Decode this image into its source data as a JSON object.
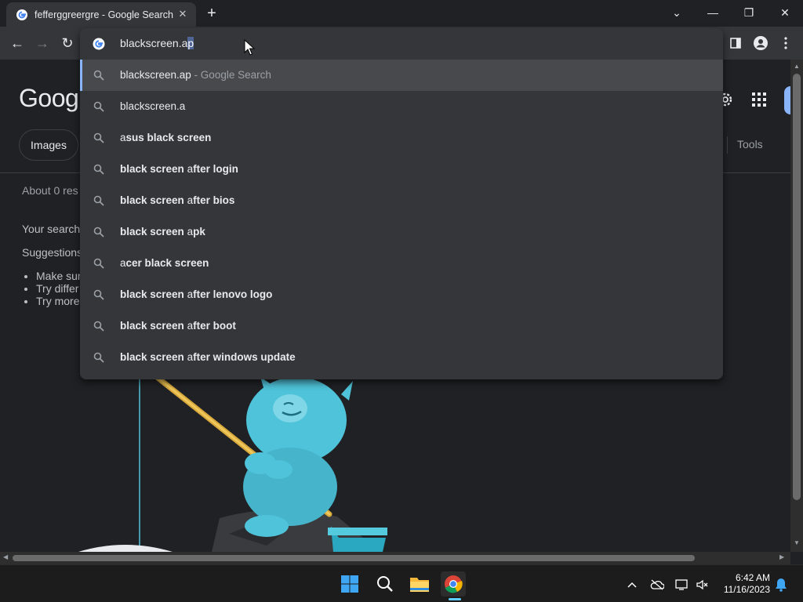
{
  "browser": {
    "tab": {
      "title": "fefferggreergre - Google Search",
      "close": "✕"
    },
    "new_tab": "+",
    "window_controls": [
      "⌄",
      "—",
      "❐",
      "✕"
    ]
  },
  "omnibox": {
    "value_prefix": "blackscreen.a",
    "value_selected": "p",
    "suggestions": [
      {
        "bold": "",
        "plain": "blackscreen.ap",
        "suffix": " - Google Search",
        "highlighted": true
      },
      {
        "bold": "",
        "plain": "blackscreen.a",
        "suffix": ""
      },
      {
        "plain_prefix": "a",
        "bold": "sus black screen"
      },
      {
        "bold": "black screen ",
        "plain_prefix2": "a",
        "bold2": "fter login"
      },
      {
        "bold": "black screen ",
        "plain_prefix2": "a",
        "bold2": "fter bios"
      },
      {
        "bold": "black screen ",
        "plain_prefix2": "a",
        "bold2": "pk"
      },
      {
        "plain_prefix": "a",
        "bold": "cer black screen"
      },
      {
        "bold": "black screen ",
        "plain_prefix2": "a",
        "bold2": "fter lenovo logo"
      },
      {
        "bold": "black screen ",
        "plain_prefix2": "a",
        "bold2": "fter boot"
      },
      {
        "bold": "black screen ",
        "plain_prefix2": "a",
        "bold2": "fter windows update"
      }
    ]
  },
  "page": {
    "logo": "Googl",
    "images_chip": "Images",
    "tools": "Tools",
    "stats": "About 0 res",
    "no_results": "Your search",
    "suggestions_label": "Suggestions",
    "tips": [
      "Make sur",
      "Try differ",
      "Try more"
    ]
  },
  "taskbar": {
    "time": "6:42 AM",
    "date": "11/16/2023"
  },
  "colors": {
    "background": "#202124",
    "toolbar": "#35363a",
    "accent": "#8ab4f8",
    "mascot": "#4fc3d9"
  }
}
